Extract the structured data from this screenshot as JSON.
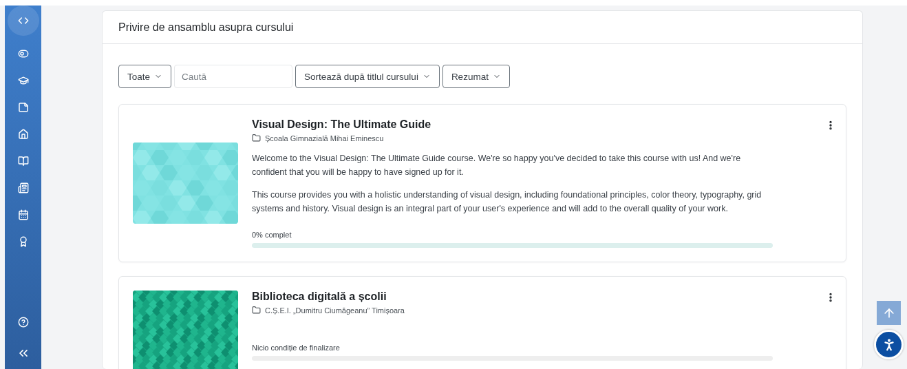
{
  "sidebar": {
    "items": [
      {
        "selected": true
      },
      {
        "selected": false
      },
      {
        "selected": false
      },
      {
        "selected": false
      },
      {
        "selected": false
      },
      {
        "selected": false
      },
      {
        "selected": false
      },
      {
        "selected": false
      },
      {
        "selected": false
      }
    ]
  },
  "panel": {
    "title": "Privire de ansamblu asupra cursului"
  },
  "filters": {
    "grouping": "Toate",
    "search": {
      "placeholder": "Caută"
    },
    "sort": "Sortează după titlul cursului",
    "view": "Rezumat"
  },
  "courses": [
    {
      "title": "Visual Design: The Ultimate Guide",
      "category": "Școala Gimnazială Mihai Eminescu",
      "image": {
        "kind": "hexagons"
      },
      "summary": [
        "Welcome to the Visual Design: The Ultimate Guide course. We're so happy you've decided to take this course with us! And we're confident that you will be happy to have signed up for it.",
        "This course provides you with a holistic understanding of visual design, including foundational principles, color theory, typography, grid systems and history. Visual design is an integral part of your user's experience and will add to the overall quality of your work."
      ],
      "progress": {
        "kind": "tracked",
        "label": "0% complet",
        "level": 0
      }
    },
    {
      "title": "Biblioteca digitală a școlii",
      "category": "C.Ș.E.I. „Dumitru Ciumăgeanu” Timișoara",
      "image": {
        "kind": "diamonds"
      },
      "progress": {
        "kind": "untracked",
        "label": "Nicio condiție de finalizare",
        "level": 0
      }
    }
  ]
}
